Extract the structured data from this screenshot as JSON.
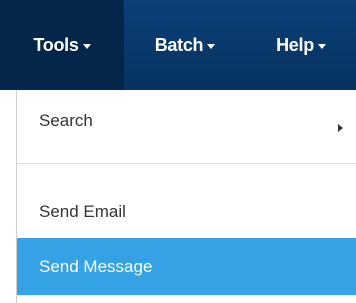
{
  "menubar": {
    "items": [
      {
        "label": "Tools",
        "state": "open"
      },
      {
        "label": "Batch"
      },
      {
        "label": "Help"
      }
    ]
  },
  "dropdown": {
    "items": [
      {
        "label": "Search",
        "has_submenu": true
      },
      {
        "label": "Send Email"
      },
      {
        "label": "Send Message",
        "highlighted": true
      }
    ]
  },
  "colors": {
    "menubar_bg": "#0c3e78",
    "active_menu_bg": "#03264a",
    "highlight_bg": "#35a2e6",
    "text": "#333333"
  }
}
